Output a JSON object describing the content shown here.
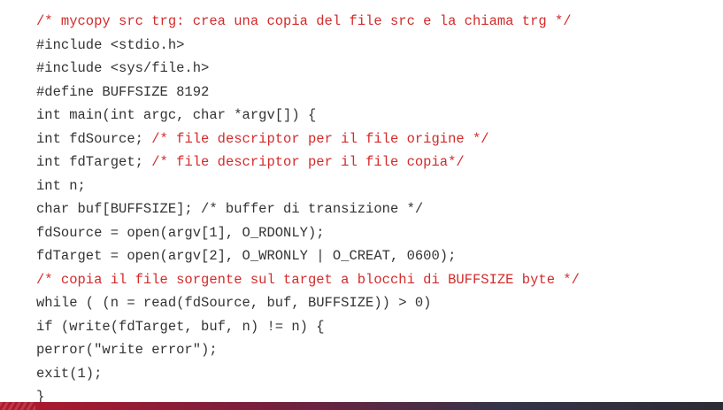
{
  "code": {
    "lines": [
      [
        {
          "t": "/* mycopy src trg: crea una copia del file src e la chiama trg */",
          "c": "comment"
        }
      ],
      [
        {
          "t": "#include <stdio.h>",
          "c": "code"
        }
      ],
      [
        {
          "t": "#include <sys/file.h>",
          "c": "code"
        }
      ],
      [
        {
          "t": "#define BUFFSIZE 8192",
          "c": "code"
        }
      ],
      [
        {
          "t": "int main(int argc, char *argv[]) {",
          "c": "code"
        }
      ],
      [
        {
          "t": "int fdSource; ",
          "c": "code"
        },
        {
          "t": "/* file descriptor per il file origine */",
          "c": "comment"
        }
      ],
      [
        {
          "t": "int fdTarget; ",
          "c": "code"
        },
        {
          "t": "/* file descriptor per il file copia*/",
          "c": "comment"
        }
      ],
      [
        {
          "t": "int n;",
          "c": "code"
        }
      ],
      [
        {
          "t": "char buf[BUFFSIZE]; /* buffer di transizione */",
          "c": "code"
        }
      ],
      [
        {
          "t": "fdSource = open(argv[1], O_RDONLY);",
          "c": "code"
        }
      ],
      [
        {
          "t": "fdTarget = open(argv[2], O_WRONLY | O_CREAT, 0600);",
          "c": "code"
        }
      ],
      [
        {
          "t": "/* copia il file sorgente sul target a blocchi di BUFFSIZE byte */",
          "c": "comment"
        }
      ],
      [
        {
          "t": "while ( (n = read(fdSource, buf, BUFFSIZE)) > 0)",
          "c": "code"
        }
      ],
      [
        {
          "t": "if (write(fdTarget, buf, n) != n) {",
          "c": "code"
        }
      ],
      [
        {
          "t": "perror(\"write error\");",
          "c": "code"
        }
      ],
      [
        {
          "t": "exit(1);",
          "c": "code"
        }
      ],
      [
        {
          "t": "}",
          "c": "code"
        }
      ]
    ]
  },
  "colors": {
    "code": "#333333",
    "comment": "#d32b2b",
    "bar_start": "#b2182b",
    "bar_end": "#2c2c34"
  }
}
